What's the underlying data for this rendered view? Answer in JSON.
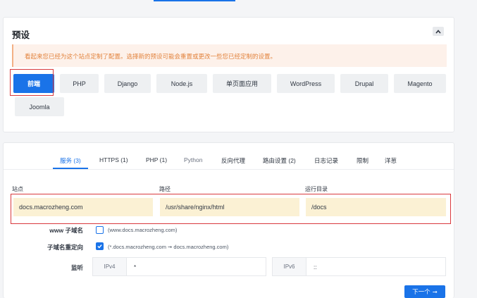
{
  "preset": {
    "title": "预设",
    "warning": "看起来您已经为这个站点定制了配置。选择新的预设可能会重置或更改一些您已经定制的设置。",
    "options": [
      "前端",
      "PHP",
      "Django",
      "Node.js",
      "单页面应用",
      "WordPress",
      "Drupal",
      "Magento",
      "Joomla"
    ],
    "selected": "前端"
  },
  "tabs": [
    {
      "label": "服务 (3)"
    },
    {
      "label": "HTTPS (1)"
    },
    {
      "label": "PHP (1)"
    },
    {
      "label": "Python"
    },
    {
      "label": "反向代理"
    },
    {
      "label": "路由设置 (2)"
    },
    {
      "label": "日志记录"
    },
    {
      "label": "限制"
    },
    {
      "label": "洋葱"
    }
  ],
  "fields": {
    "site": {
      "label": "站点",
      "value": "docs.macrozheng.com"
    },
    "path": {
      "label": "路径",
      "value": "/usr/share/nginx/html"
    },
    "root": {
      "label": "运行目录",
      "value": "/docs"
    }
  },
  "www": {
    "label": "www 子域名",
    "checked": false,
    "hint": "(www.docs.macrozheng.com)"
  },
  "redirect": {
    "label": "子域名重定向",
    "checked": true,
    "hint": "(*.docs.macrozheng.com ➞ docs.macrozheng.com)"
  },
  "listen": {
    "label": "监听",
    "ipv4": {
      "tag": "IPv4",
      "value": "*"
    },
    "ipv6": {
      "tag": "IPv6",
      "value": "::"
    }
  },
  "next_button": {
    "label": "下一个",
    "arrow": "➞"
  },
  "colors": {
    "accent": "#1a73e8",
    "highlight": "#d9393d",
    "warning_bg": "#fdf1ea",
    "input_bg": "#fbf1d4"
  }
}
